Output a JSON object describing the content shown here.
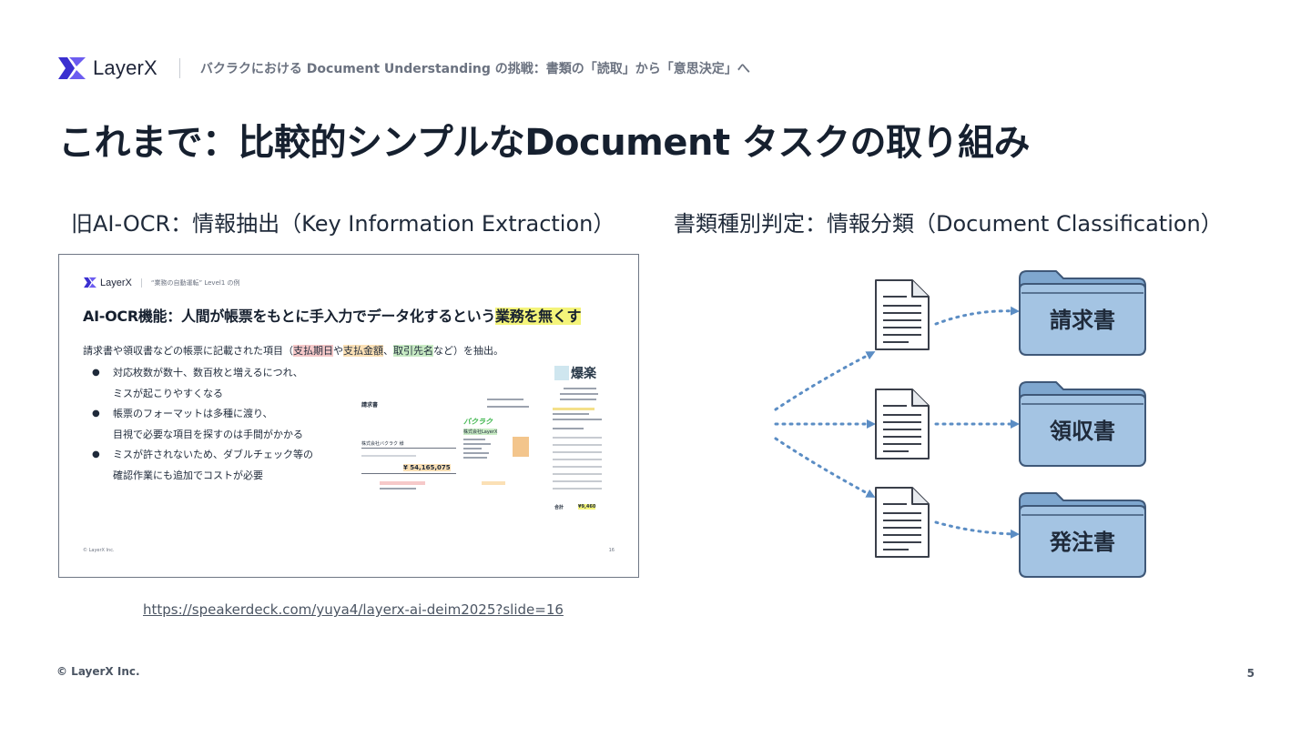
{
  "header": {
    "logo_text": "LayerX",
    "subtitle": "バクラクにおける Document Understanding の挑戦：書類の「読取」から「意思決定」へ"
  },
  "title": "これまで：比較的シンプルなDocument タスクの取り組み",
  "left": {
    "heading": "旧AI-OCR：情報抽出（Key Information Extraction）",
    "link": "https://speakerdeck.com/yuya4/layerx-ai-deim2025?slide=16",
    "slide": {
      "logo_text": "LayerX",
      "subtitle": "“業務の自動運転” Level1 の例",
      "title_main": "AI-OCR機能：人間が帳票をもとに手入力でデータ化するという",
      "title_highlight": "業務を無くす",
      "lead_prefix": "請求書や領収書などの帳票に記載された項目（",
      "lead_item1": "支払期日",
      "lead_mid1": "や",
      "lead_item2": "支払金額",
      "lead_mid2": "、",
      "lead_item3": "取引先名",
      "lead_suffix": "など）を抽出。",
      "bullets": [
        {
          "line1": "対応枚数が数十、数百枚と増えるにつれ、",
          "line2": "ミスが起こりやすくなる"
        },
        {
          "line1": "帳票のフォーマットは多種に渡り、",
          "line2": "目視で必要な項目を探すのは手間がかかる"
        },
        {
          "line1": "ミスが許されないため、ダブルチェック等の",
          "line2": "確認作業にも追加でコストが必要"
        }
      ],
      "footer": "© LayerX Inc.",
      "page": "16",
      "invoice": {
        "title": "請求書",
        "company": "株式会社バクラク 様",
        "amount": "¥ 54,165,075",
        "brand": "バクラク",
        "issuer": "株式会社LayerX"
      },
      "receipt": {
        "shop": "爆楽",
        "total_label": "合計",
        "total": "¥9,460"
      }
    }
  },
  "right": {
    "heading": "書類種別判定：情報分類（Document Classification）",
    "folders": [
      "請求書",
      "領収書",
      "発注書"
    ]
  },
  "footer": {
    "copyright": "© LayerX Inc.",
    "page": "5"
  },
  "colors": {
    "brand": "#4a3fd8",
    "folder_fill": "#8fb4d8",
    "folder_stroke": "#3f5878",
    "arrow": "#5b8dc4"
  }
}
